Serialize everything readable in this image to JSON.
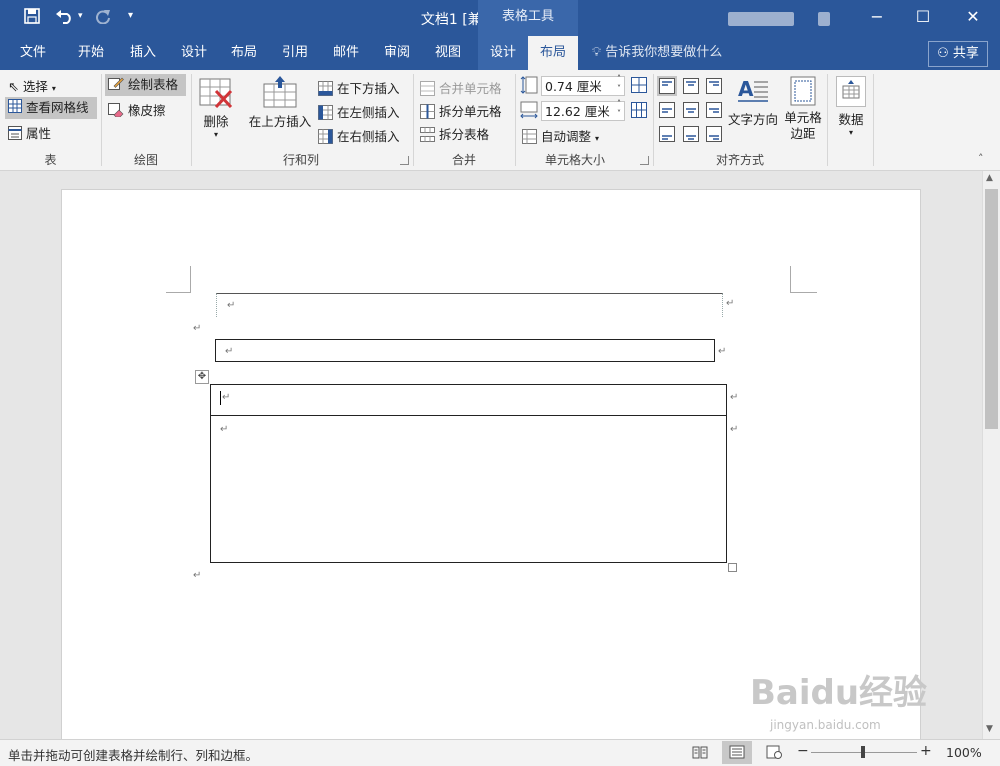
{
  "title_bar": {
    "doc_title": "文档1 [兼容模式] - Word",
    "context_group": "表格工具",
    "save_icon": "save-icon",
    "undo_icon": "undo-icon",
    "redo_icon": "redo-icon",
    "customize_icon": "customize-qat-icon"
  },
  "tabs": [
    "文件",
    "开始",
    "插入",
    "设计",
    "布局",
    "引用",
    "邮件",
    "审阅",
    "视图",
    "设计",
    "布局"
  ],
  "tell_me": "告诉我你想要做什么",
  "share": "共享",
  "ribbon": {
    "table_group": {
      "label": "表",
      "select": "选择",
      "view_gridlines": "查看网格线",
      "properties": "属性"
    },
    "draw_group": {
      "label": "绘图",
      "draw_table": "绘制表格",
      "eraser": "橡皮擦"
    },
    "rows_cols_group": {
      "label": "行和列",
      "delete": "删除",
      "insert_above": "在上方插入",
      "insert_below": "在下方插入",
      "insert_left": "在左侧插入",
      "insert_right": "在右侧插入"
    },
    "merge_group": {
      "label": "合并",
      "merge_cells": "合并单元格",
      "split_cells": "拆分单元格",
      "split_table": "拆分表格"
    },
    "cell_size_group": {
      "label": "单元格大小",
      "height": "0.74 厘米",
      "width": "12.62 厘米",
      "autofit": "自动调整"
    },
    "alignment_group": {
      "label": "对齐方式",
      "text_direction": "文字方向",
      "cell_margins_1": "单元格",
      "cell_margins_2": "边距"
    },
    "data_group": {
      "data": "数据"
    }
  },
  "document": {
    "paragraph_mark": "↵"
  },
  "status_bar": {
    "message": "单击并拖动可创建表格并绘制行、列和边框。",
    "zoom": "100%",
    "minus": "−",
    "plus": "+"
  },
  "watermark": {
    "brand": "Baidu经验",
    "site": "jingyan.baidu.com"
  }
}
